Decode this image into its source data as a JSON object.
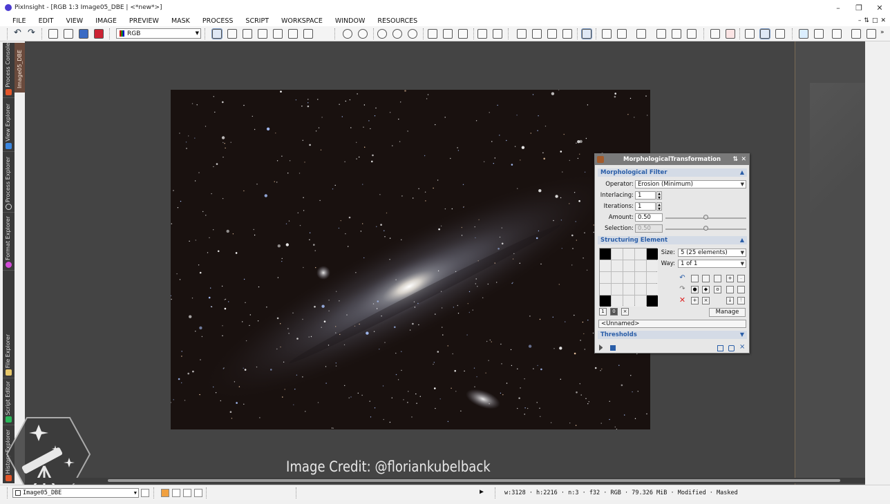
{
  "window": {
    "title": "PixInsight - [RGB 1:3 Image05_DBE | <*new*>]",
    "controls": [
      "–",
      "❐",
      "✕"
    ]
  },
  "menu": [
    "FILE",
    "EDIT",
    "VIEW",
    "IMAGE",
    "PREVIEW",
    "MASK",
    "PROCESS",
    "SCRIPT",
    "WORKSPACE",
    "WINDOW",
    "RESOURCES"
  ],
  "toolbar": {
    "channel_select": "RGB"
  },
  "left_dock": {
    "tabs": [
      "Process Console",
      "View Explorer",
      "Process Explorer",
      "Format Explorer",
      "File Explorer",
      "Script Editor",
      "History Explorer"
    ],
    "image_tab": "Image05_DBE"
  },
  "process_panel": {
    "title": "MorphologicalTransformation",
    "sections": {
      "filter": "Morphological Filter",
      "structuring": "Structuring Element",
      "thresholds": "Thresholds"
    },
    "operator": {
      "label": "Operator:",
      "value": "Erosion (Minimum)"
    },
    "interlacing": {
      "label": "Interlacing:",
      "value": "1"
    },
    "iterations": {
      "label": "Iterations:",
      "value": "1"
    },
    "amount": {
      "label": "Amount:",
      "value": "0.50",
      "slider": 0.5
    },
    "selection": {
      "label": "Selection:",
      "value": "0.50",
      "slider": 0.5
    },
    "size": {
      "label": "Size:",
      "value": "5  (25 elements)"
    },
    "way": {
      "label": "Way:",
      "value": "1 of 1"
    },
    "structure_grid": [
      1,
      0,
      0,
      0,
      1,
      0,
      0,
      0,
      0,
      0,
      0,
      0,
      0,
      0,
      0,
      0,
      0,
      0,
      0,
      0,
      1,
      0,
      0,
      0,
      1
    ],
    "manage_label": "Manage",
    "structure_name": "<Unnamed>"
  },
  "credit": "Image Credit: @floriankubelback",
  "status": {
    "view": "Image05_DBE",
    "info": "w:3128 · h:2216 · n:3 · f32 · RGB · 79.326 MiB · Modified · Masked"
  },
  "colors": {
    "accent": "#2a5ea8",
    "image_tab": "#6a4a3c"
  }
}
